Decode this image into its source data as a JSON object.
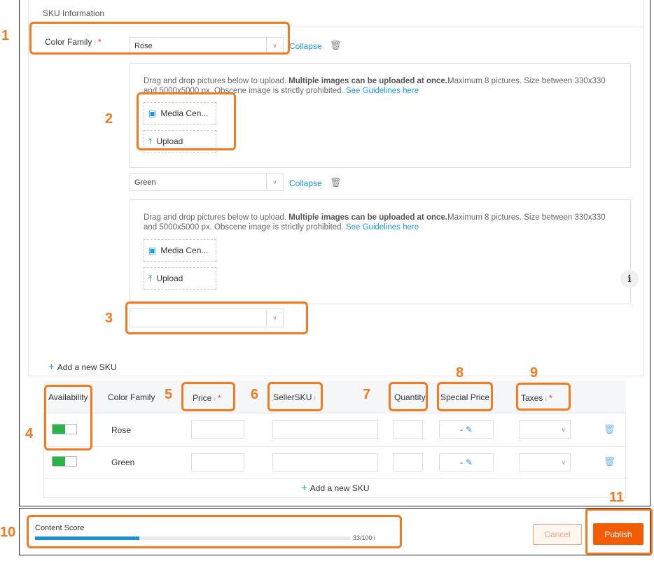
{
  "section": {
    "title": "SKU Information"
  },
  "color_family": {
    "label": "Color Family",
    "info_mark": "i",
    "required_mark": "*",
    "variants": [
      {
        "value": "Rose",
        "collapse_label": "Collapse",
        "upload_text_1": "Drag and drop pictures below to upload. ",
        "upload_bold": "Multiple images can be uploaded at once.",
        "upload_text_2": "Maximum 8 pictures. Size between 330x330 and 5000x5000 px. Obscene image is strictly prohibited.",
        "guidelines_link": "See Guidelines here",
        "media_center_label": "Media Cen...",
        "upload_label": "Upload"
      },
      {
        "value": "Green",
        "collapse_label": "Collapse",
        "upload_text_1": "Drag and drop pictures below to upload. ",
        "upload_bold": "Multiple images can be uploaded at once.",
        "upload_text_2": "Maximum 8 pictures. Size between 330x330 and 5000x5000 px. Obscene image is strictly prohibited.",
        "guidelines_link": "See Guidelines here",
        "media_center_label": "Media Cen...",
        "upload_label": "Upload"
      }
    ],
    "empty_select_value": ""
  },
  "add_sku_top": "Add a new SKU",
  "table": {
    "headers": {
      "availability": "Availability",
      "color_family": "Color Family",
      "price": "Price",
      "seller_sku": "SellerSKU",
      "quantity": "Quantity",
      "special_price": "Special Price",
      "taxes": "Taxes"
    },
    "rows": [
      {
        "color": "Rose",
        "available": true,
        "special_price": "-"
      },
      {
        "color": "Green",
        "available": true,
        "special_price": "-"
      }
    ],
    "add_sku_bottom": "Add a new SKU"
  },
  "annotations": [
    "1",
    "2",
    "3",
    "4",
    "5",
    "6",
    "7",
    "8",
    "9",
    "10",
    "11"
  ],
  "footer": {
    "content_score_label": "Content Score",
    "content_score_value": 33,
    "content_score_text": "33/100",
    "cancel_label": "Cancel",
    "publish_label": "Publish"
  },
  "colors": {
    "accent_orange": "#f47a20",
    "publish_bg": "#f25c05",
    "link_blue": "#1a9ad9",
    "toggle_green": "#2bb34a"
  }
}
